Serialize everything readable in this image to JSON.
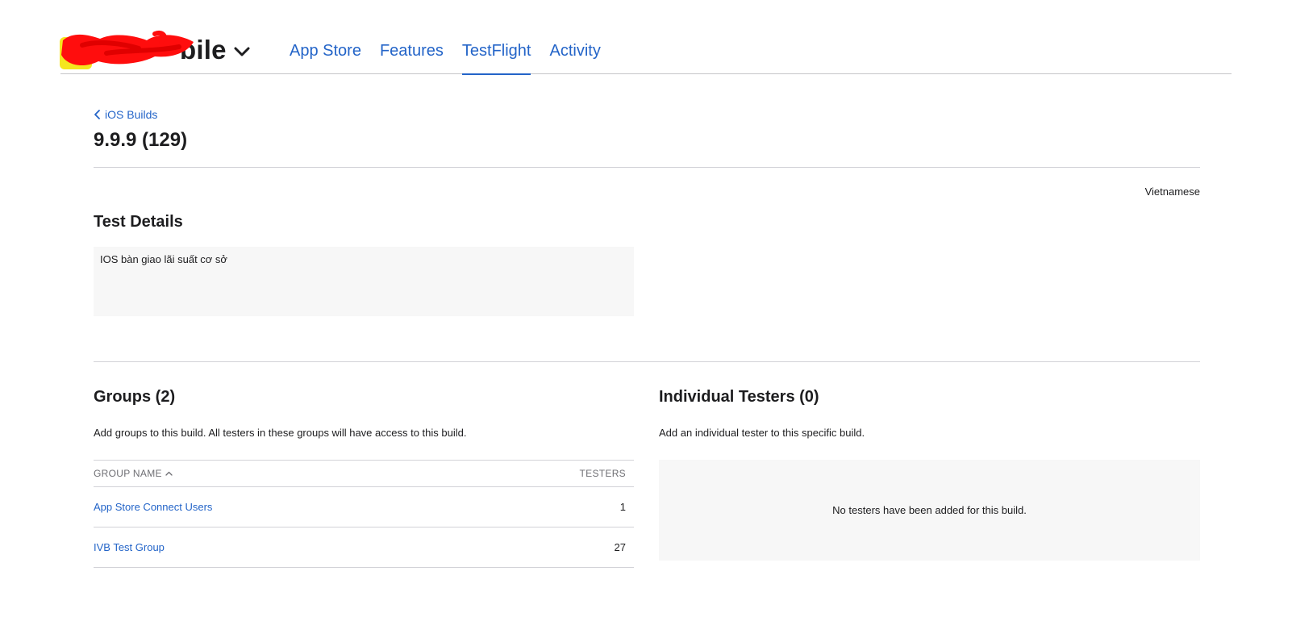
{
  "header": {
    "app_name": "bile",
    "tabs": [
      {
        "label": "App Store",
        "active": false
      },
      {
        "label": "Features",
        "active": false
      },
      {
        "label": "TestFlight",
        "active": true
      },
      {
        "label": "Activity",
        "active": false
      }
    ]
  },
  "build": {
    "breadcrumb": "iOS Builds",
    "title": "9.9.9 (129)",
    "locale": "Vietnamese"
  },
  "test_details": {
    "title": "Test Details",
    "notes": "IOS bàn giao lãi suất cơ sở"
  },
  "groups": {
    "title": "Groups (2)",
    "description": "Add groups to this build. All testers in these groups will have access to this build.",
    "columns": {
      "name": "GROUP NAME",
      "testers": "TESTERS"
    },
    "rows": [
      {
        "name": "App Store Connect Users",
        "testers": "1"
      },
      {
        "name": "IVB Test Group",
        "testers": "27"
      }
    ]
  },
  "individual_testers": {
    "title": "Individual Testers (0)",
    "description": "Add an individual tester to this specific build.",
    "empty_message": "No testers have been added for this build."
  },
  "colors": {
    "link": "#2364c8",
    "text": "#1d1d1f",
    "panel": "#f7f7f7",
    "divider": "#d2d2d7",
    "redaction": "#ff0000",
    "app_icon": "#f5e61e"
  },
  "icons": {
    "app_switcher": "chevron-down-icon",
    "breadcrumb_back": "chevron-left-icon",
    "sort": "sort-up-icon"
  }
}
